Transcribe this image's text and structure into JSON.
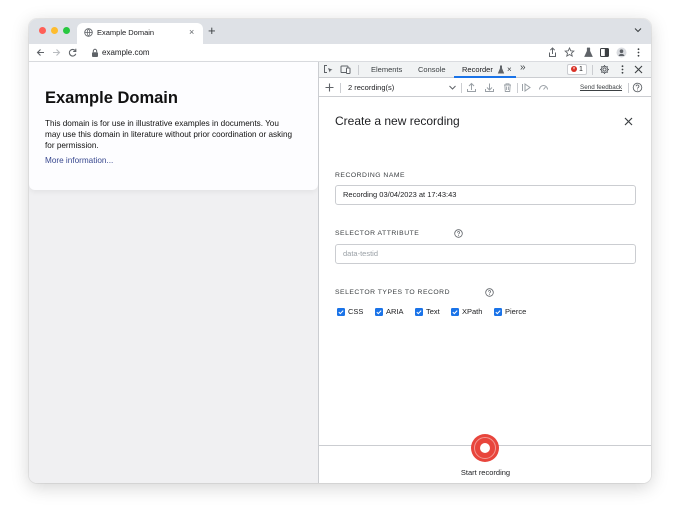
{
  "browser": {
    "tab_title": "Example Domain",
    "tab_close": "×",
    "new_tab": "+",
    "url": "example.com"
  },
  "page": {
    "title": "Example Domain",
    "body": "This domain is for use in illustrative examples in documents. You may use this domain in literature without prior coordination or asking for permission.",
    "link": "More information..."
  },
  "devtools": {
    "tabs": [
      "Elements",
      "Console",
      "Recorder"
    ],
    "more_tabs": "»",
    "error_count": "1",
    "recordings_select": "2 recording(s)",
    "send_feedback": "Send feedback"
  },
  "recorder": {
    "panel_title": "Create a new recording",
    "recording_name_label": "RECORDING NAME",
    "recording_name_value": "Recording 03/04/2023 at 17:43:43",
    "selector_attribute_label": "SELECTOR ATTRIBUTE",
    "selector_attribute_placeholder": "data-testid",
    "selector_types_label": "SELECTOR TYPES TO RECORD",
    "selector_types": [
      {
        "label": "CSS",
        "checked": true
      },
      {
        "label": "ARIA",
        "checked": true
      },
      {
        "label": "Text",
        "checked": true
      },
      {
        "label": "XPath",
        "checked": true
      },
      {
        "label": "Pierce",
        "checked": true
      }
    ],
    "start_label": "Start recording"
  },
  "colors": {
    "accent": "#1a73e8",
    "record_button": "#e8453c",
    "link": "#38488f"
  }
}
